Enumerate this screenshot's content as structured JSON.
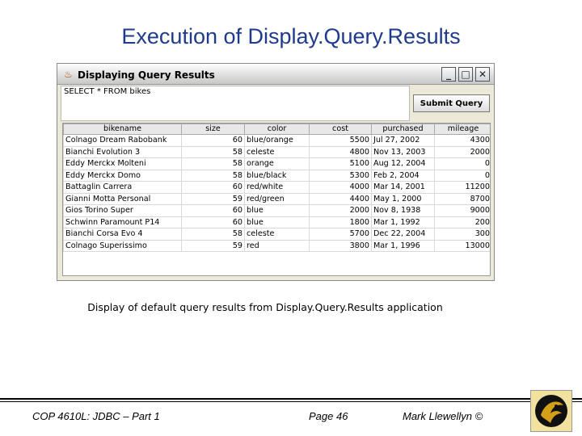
{
  "slide": {
    "title": "Execution of Display.Query.Results",
    "caption": "Display of default query results from Display.Query.Results application"
  },
  "window": {
    "title": "Displaying Query Results",
    "icon": "java-cup-icon",
    "controls": {
      "minimize": "_",
      "maximize": "□",
      "close": "✕"
    }
  },
  "query": {
    "text": "SELECT * FROM bikes"
  },
  "submit_label": "Submit Query",
  "table": {
    "columns": [
      "bikename",
      "size",
      "color",
      "cost",
      "purchased",
      "mileage"
    ],
    "rows": [
      [
        "Colnago Dream Rabobank",
        "60",
        "blue/orange",
        "5500",
        "Jul 27, 2002",
        "4300"
      ],
      [
        "Bianchi Evolution 3",
        "58",
        "celeste",
        "4800",
        "Nov 13, 2003",
        "2000"
      ],
      [
        "Eddy Merckx Molteni",
        "58",
        "orange",
        "5100",
        "Aug 12, 2004",
        "0"
      ],
      [
        "Eddy Merckx Domo",
        "58",
        "blue/black",
        "5300",
        "Feb 2, 2004",
        "0"
      ],
      [
        "Battaglin Carrera",
        "60",
        "red/white",
        "4000",
        "Mar 14, 2001",
        "11200"
      ],
      [
        "Gianni Motta Personal",
        "59",
        "red/green",
        "4400",
        "May 1, 2000",
        "8700"
      ],
      [
        "Gios Torino Super",
        "60",
        "blue",
        "2000",
        "Nov 8, 1938",
        "9000"
      ],
      [
        "Schwinn Paramount P14",
        "60",
        "blue",
        "1800",
        "Mar 1, 1992",
        "200"
      ],
      [
        "Bianchi Corsa Evo 4",
        "58",
        "celeste",
        "5700",
        "Dec 22, 2004",
        "300"
      ],
      [
        "Colnago Superissimo",
        "59",
        "red",
        "3800",
        "Mar 1, 1996",
        "13000"
      ]
    ]
  },
  "footer": {
    "course": "COP 4610L: JDBC – Part 1",
    "page": "Page 46",
    "author": "Mark Llewellyn ©"
  },
  "colors": {
    "title": "#1f3a8a",
    "window_bg": "#ece9d8",
    "logo_bg": "#f2e2a0"
  }
}
